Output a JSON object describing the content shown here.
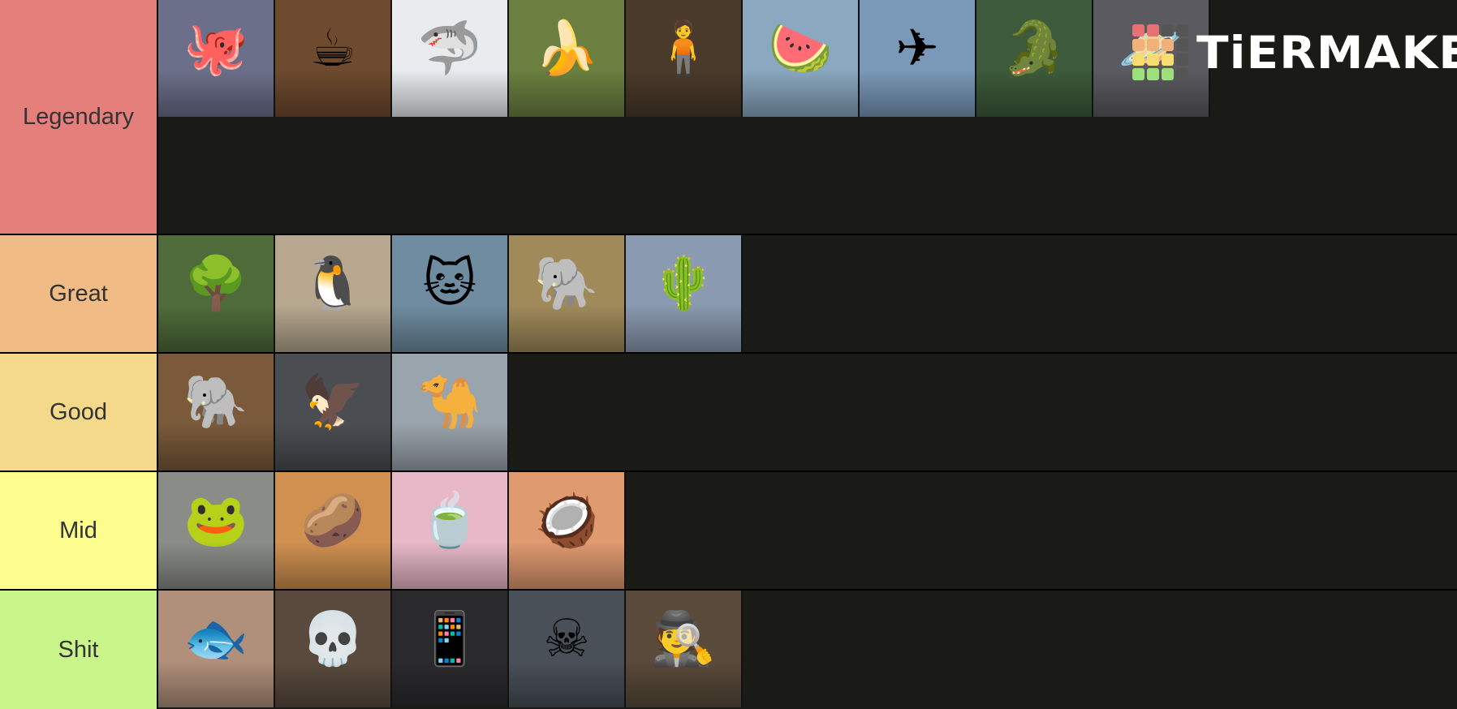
{
  "brand": {
    "name": "TiERMAKER",
    "grid_colors": [
      "#e57373",
      "#e57373",
      "#555555",
      "#555555",
      "#f0b27a",
      "#f0b27a",
      "#f0b27a",
      "#555555",
      "#f7dc6f",
      "#f7dc6f",
      "#f7dc6f",
      "#555555",
      "#9be07a",
      "#9be07a",
      "#9be07a",
      "#555555"
    ]
  },
  "tiers": [
    {
      "label": "Legendary",
      "color": "#e57f7c",
      "items": [
        {
          "icon": "octopus-icon",
          "glyph": "🐙",
          "bg": "#6b6f8a"
        },
        {
          "icon": "coffee-cup-ninja-icon",
          "glyph": "☕",
          "bg": "#6e4a2e"
        },
        {
          "icon": "shark-sneakers-icon",
          "glyph": "🦈",
          "bg": "#e8ecef"
        },
        {
          "icon": "banana-monkey-icon",
          "glyph": "🍌",
          "bg": "#6b8040"
        },
        {
          "icon": "wooden-figure-icon",
          "glyph": "🧍",
          "bg": "#4a3a2a"
        },
        {
          "icon": "watermelon-giraffe-icon",
          "glyph": "🍉",
          "bg": "#8aa8c0"
        },
        {
          "icon": "crocodile-plane-icon",
          "glyph": "✈",
          "bg": "#7a98b8"
        },
        {
          "icon": "watermelon-crocodile-icon",
          "glyph": "🐊",
          "bg": "#3d5a3a"
        },
        {
          "icon": "saturn-cow-icon",
          "glyph": "🪐",
          "bg": "#5a5a60"
        }
      ]
    },
    {
      "label": "Great",
      "color": "#f0bb84",
      "items": [
        {
          "icon": "tree-man-icon",
          "glyph": "🌳",
          "bg": "#4f6b3a"
        },
        {
          "icon": "penguin-coffee-icon",
          "glyph": "🐧",
          "bg": "#b7a88f"
        },
        {
          "icon": "shrimp-cat-icon",
          "glyph": "🐱",
          "bg": "#6f8ca0"
        },
        {
          "icon": "cactus-elephant-icon",
          "glyph": "🐘",
          "bg": "#a08a5a"
        },
        {
          "icon": "cactus-hippo-icon",
          "glyph": "🌵",
          "bg": "#8a9ab0"
        }
      ]
    },
    {
      "label": "Good",
      "color": "#f4d98a",
      "items": [
        {
          "icon": "coconut-elephant-icon",
          "glyph": "🐘",
          "bg": "#7a5a3a"
        },
        {
          "icon": "eagle-goose-icon",
          "glyph": "🦅",
          "bg": "#4a4d52"
        },
        {
          "icon": "camel-fridge-icon",
          "glyph": "🐪",
          "bg": "#9aa4ac"
        }
      ]
    },
    {
      "label": "Mid",
      "color": "#fdfd8e",
      "items": [
        {
          "icon": "frog-tire-icon",
          "glyph": "🐸",
          "bg": "#8a8c88"
        },
        {
          "icon": "potato-cowboy-icon",
          "glyph": "🥔",
          "bg": "#d09050"
        },
        {
          "icon": "teacup-ballerina-icon",
          "glyph": "🍵",
          "bg": "#e8b8c8"
        },
        {
          "icon": "coconut-beaver-icon",
          "glyph": "🥥",
          "bg": "#e09a70"
        }
      ]
    },
    {
      "label": "Shit",
      "color": "#c9f58a",
      "items": [
        {
          "icon": "fish-cat-icon",
          "glyph": "🐟",
          "bg": "#b0907a"
        },
        {
          "icon": "skeleton-desk-icon",
          "glyph": "💀",
          "bg": "#5a4a3e"
        },
        {
          "icon": "skeleton-phone-icon",
          "glyph": "📱",
          "bg": "#2a2a2c"
        },
        {
          "icon": "skeleton-rain-icon",
          "glyph": "☠",
          "bg": "#4a5058"
        },
        {
          "icon": "beaver-detective-icon",
          "glyph": "🕵",
          "bg": "#5a4a3a"
        }
      ]
    }
  ]
}
